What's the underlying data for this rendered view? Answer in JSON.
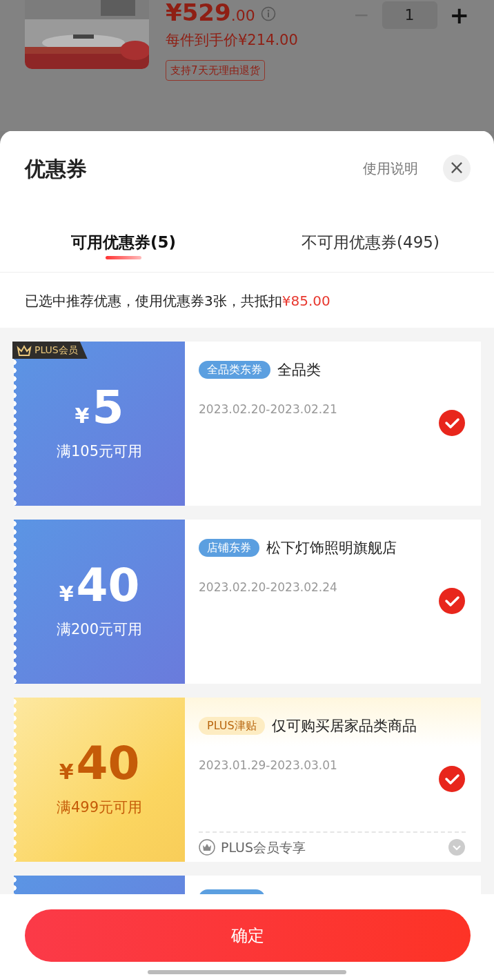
{
  "product": {
    "price": "¥529",
    "price_decimals": ".00",
    "per_item_price": "每件到手价¥214.00",
    "return_tag": "支持7天无理由退货",
    "quantity": "1",
    "minus": "−",
    "plus": "+"
  },
  "sheet": {
    "title": "优惠券",
    "help_link": "使用说明",
    "close": "×"
  },
  "tabs": [
    {
      "label": "可用优惠券(5)",
      "selected": true
    },
    {
      "label": "不可用优惠券(495)",
      "selected": false
    }
  ],
  "summary": {
    "text": "已选中推荐优惠，使用优惠券3张，共抵扣",
    "amount": "¥85.00"
  },
  "coupons": [
    {
      "kind": "blue",
      "badge": "PLUS会员",
      "currency": "¥",
      "amount": "5",
      "condition": "满105元可用",
      "tag": "全品类东券",
      "title": "全品类",
      "validity": "2023.02.20-2023.02.21",
      "selected": true
    },
    {
      "kind": "blue",
      "currency": "¥",
      "amount": "40",
      "condition": "满200元可用",
      "tag": "店铺东券",
      "title": "松下灯饰照明旗舰店",
      "validity": "2023.02.20-2023.02.24",
      "selected": true
    },
    {
      "kind": "gold",
      "currency": "¥",
      "amount": "40",
      "condition": "满499元可用",
      "tag": "PLUS津贴",
      "title": "仅可购买居家品类商品",
      "validity": "2023.01.29-2023.03.01",
      "selected": true,
      "footer": "PLUS会员专享"
    },
    {
      "kind": "blue"
    }
  ],
  "confirm_button": "确定"
}
